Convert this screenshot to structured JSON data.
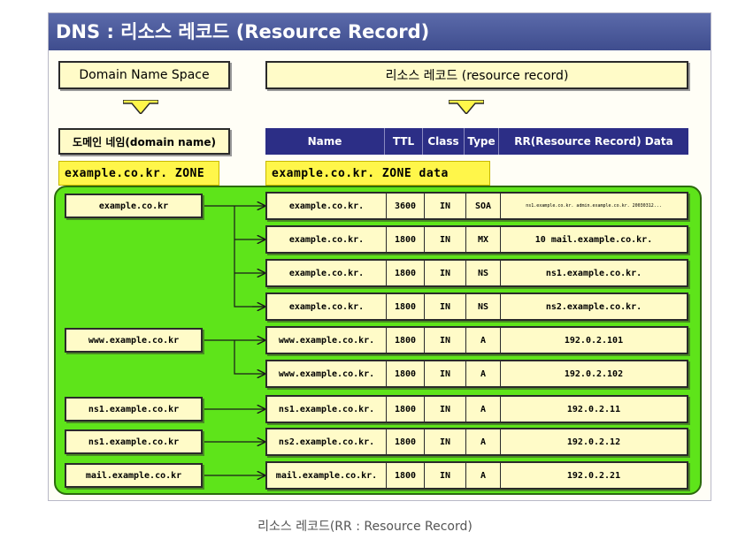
{
  "title": "DNS : 리소스 레코드 (Resource Record)",
  "left_header": "Domain Name Space",
  "right_header": "리소스 레코드 (resource record)",
  "domain_name_label": "도메인 네임(domain name)",
  "table_columns": {
    "name": "Name",
    "ttl": "TTL",
    "class": "Class",
    "type": "Type",
    "data": "RR(Resource Record) Data"
  },
  "zone_label": "example.co.kr. ZONE",
  "zone_data_label": "example.co.kr. ZONE data",
  "domains": [
    "example.co.kr",
    "www.example.co.kr",
    "ns1.example.co.kr",
    "ns1.example.co.kr",
    "mail.example.co.kr"
  ],
  "records": [
    {
      "name": "example.co.kr.",
      "ttl": "3600",
      "class": "IN",
      "type": "SOA",
      "data": "ns1.example.co.kr. admin.example.co.kr. 20030312..."
    },
    {
      "name": "example.co.kr.",
      "ttl": "1800",
      "class": "IN",
      "type": "MX",
      "data": "10 mail.example.co.kr."
    },
    {
      "name": "example.co.kr.",
      "ttl": "1800",
      "class": "IN",
      "type": "NS",
      "data": "ns1.example.co.kr."
    },
    {
      "name": "example.co.kr.",
      "ttl": "1800",
      "class": "IN",
      "type": "NS",
      "data": "ns2.example.co.kr."
    },
    {
      "name": "www.example.co.kr.",
      "ttl": "1800",
      "class": "IN",
      "type": "A",
      "data": "192.0.2.101"
    },
    {
      "name": "www.example.co.kr.",
      "ttl": "1800",
      "class": "IN",
      "type": "A",
      "data": "192.0.2.102"
    },
    {
      "name": "ns1.example.co.kr.",
      "ttl": "1800",
      "class": "IN",
      "type": "A",
      "data": "192.0.2.11"
    },
    {
      "name": "ns2.example.co.kr.",
      "ttl": "1800",
      "class": "IN",
      "type": "A",
      "data": "192.0.2.12"
    },
    {
      "name": "mail.example.co.kr.",
      "ttl": "1800",
      "class": "IN",
      "type": "A",
      "data": "192.0.2.21"
    }
  ],
  "caption": "리소스 레코드(RR : Resource Record)",
  "colors": {
    "title_bar": "#4a58a0",
    "table_header": "#2c2e86",
    "panel_green": "#5ee41a",
    "box_yellow": "#fffbc8",
    "zone_yellow": "#fff64a"
  }
}
